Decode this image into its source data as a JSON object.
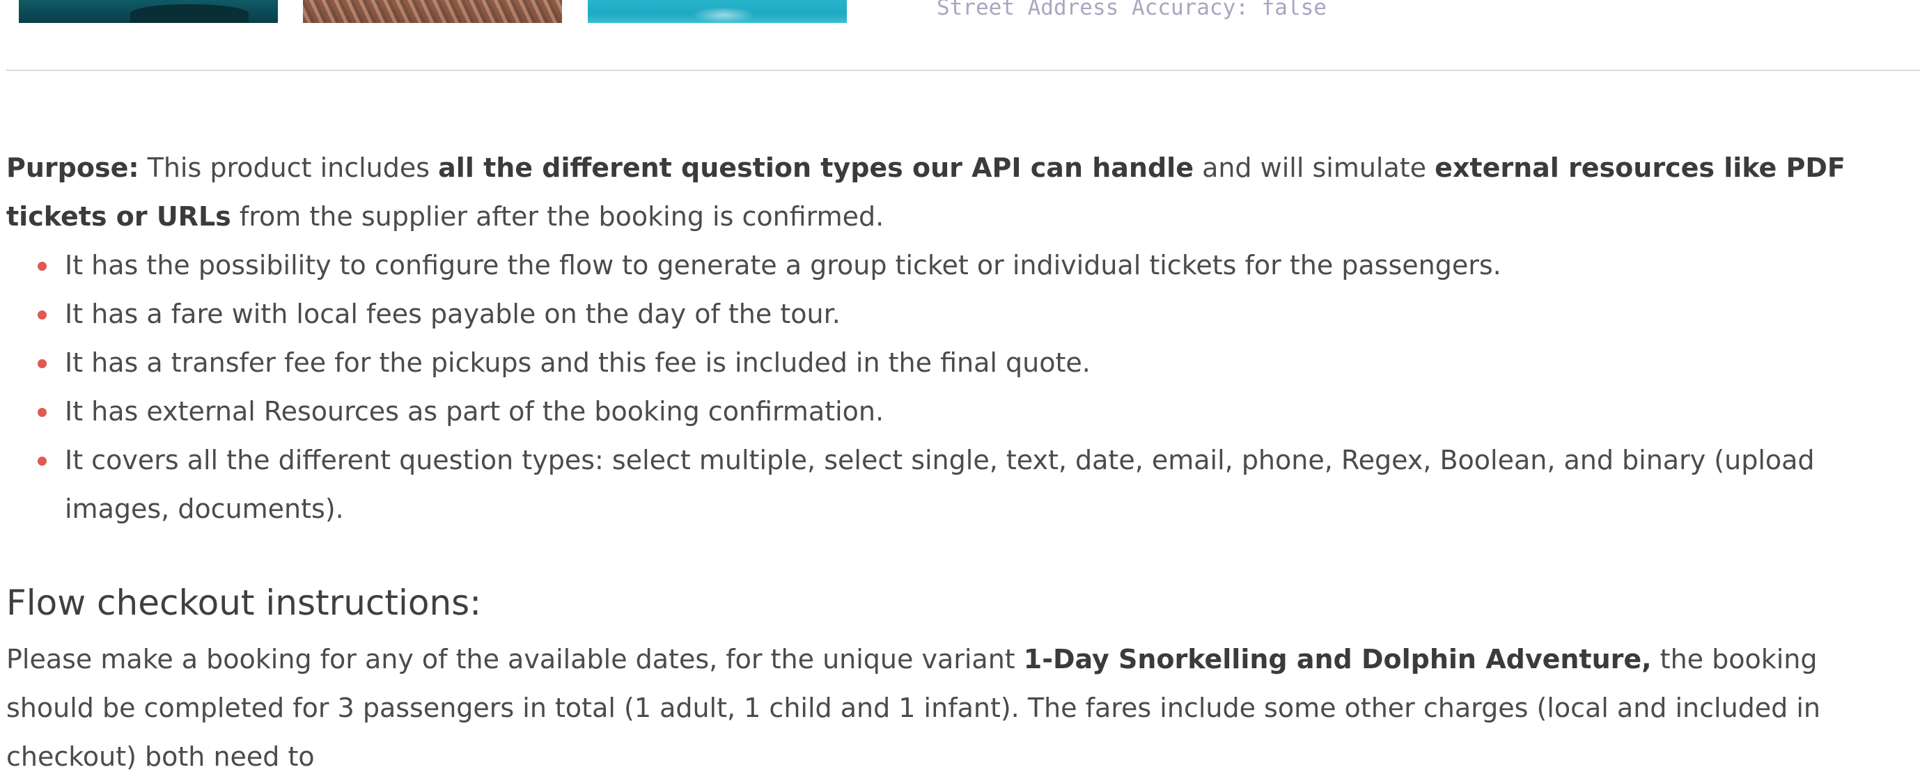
{
  "top_strip": {
    "images": [
      {
        "name": "sea-boat-photo"
      },
      {
        "name": "coral-reef-photo"
      },
      {
        "name": "lagoon-photo"
      }
    ],
    "address_accuracy_text": "Street Address Accuracy: false"
  },
  "purpose": {
    "label": "Purpose:",
    "text_1": " This product includes ",
    "bold_1": "all the different question types our API can handle",
    "text_2": " and will simulate ",
    "bold_2": "external resources like PDF tickets or URLs",
    "text_3": " from the supplier after the booking is confirmed.",
    "bullets": [
      "It has the possibility to configure the flow to generate a group ticket or individual tickets for the passengers.",
      "It has a fare with local fees payable on the day of the tour.",
      "It has a transfer fee for the pickups and this fee is included in the final quote.",
      "It has external Resources as part of the booking confirmation.",
      "It covers all the different question types: select multiple, select single, text, date, email, phone, Regex, Boolean, and binary (upload images, documents)."
    ]
  },
  "checkout": {
    "heading": "Flow checkout instructions:",
    "text_1": "Please make a booking for any of the available dates, for the unique variant ",
    "bold_1": "1-Day Snorkelling and Dolphin Adventure,",
    "text_2": " the booking should be completed for 3 passengers in total (1 adult, 1 child and 1 infant). The fares include some other charges (local and included in checkout) both need to"
  },
  "colors": {
    "bullet": "#e05a50",
    "text": "#4b4b4b",
    "mono_text": "#a7a7c2",
    "divider": "#d9d9d9"
  }
}
